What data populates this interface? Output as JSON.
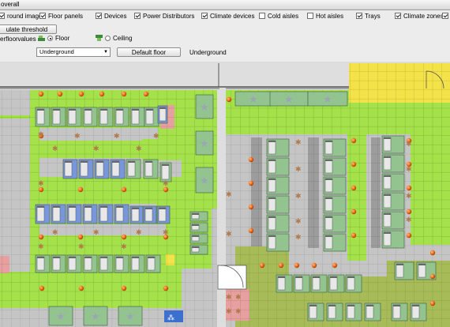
{
  "window": {
    "title": "overall"
  },
  "layers": [
    {
      "label": "round image",
      "checked": true
    },
    {
      "label": "Floor panels",
      "checked": true
    },
    {
      "label": "Devices",
      "checked": true
    },
    {
      "label": "Power Distributors",
      "checked": true
    },
    {
      "label": "Climate devices",
      "checked": true
    },
    {
      "label": "Cold aisles",
      "checked": false
    },
    {
      "label": "Hot aisles",
      "checked": false
    },
    {
      "label": "Trays",
      "checked": true
    },
    {
      "label": "Climate zones",
      "checked": true
    }
  ],
  "threshold_button": "ulate threshold values",
  "view": {
    "section_label": "erfloor",
    "floor_label": "Floor",
    "ceiling_label": "Ceiling",
    "selected": "Floor"
  },
  "floor_select": {
    "value": "Underground"
  },
  "default_floor_button": "Default floor",
  "current_floor": "Underground",
  "colors": {
    "green": "#a4e14a",
    "gray_panel": "#c5c5c5",
    "dark_panel": "#9c9c9c",
    "yellow": "#f3e24a",
    "pink": "#e6a0a0",
    "rack": "#93c490",
    "blue_rack": "#7896dc",
    "olive": "#a7bb59"
  },
  "icons": [
    "rack-icon",
    "climate-orb-icon",
    "fan-icon",
    "star-icon",
    "door-icon"
  ]
}
